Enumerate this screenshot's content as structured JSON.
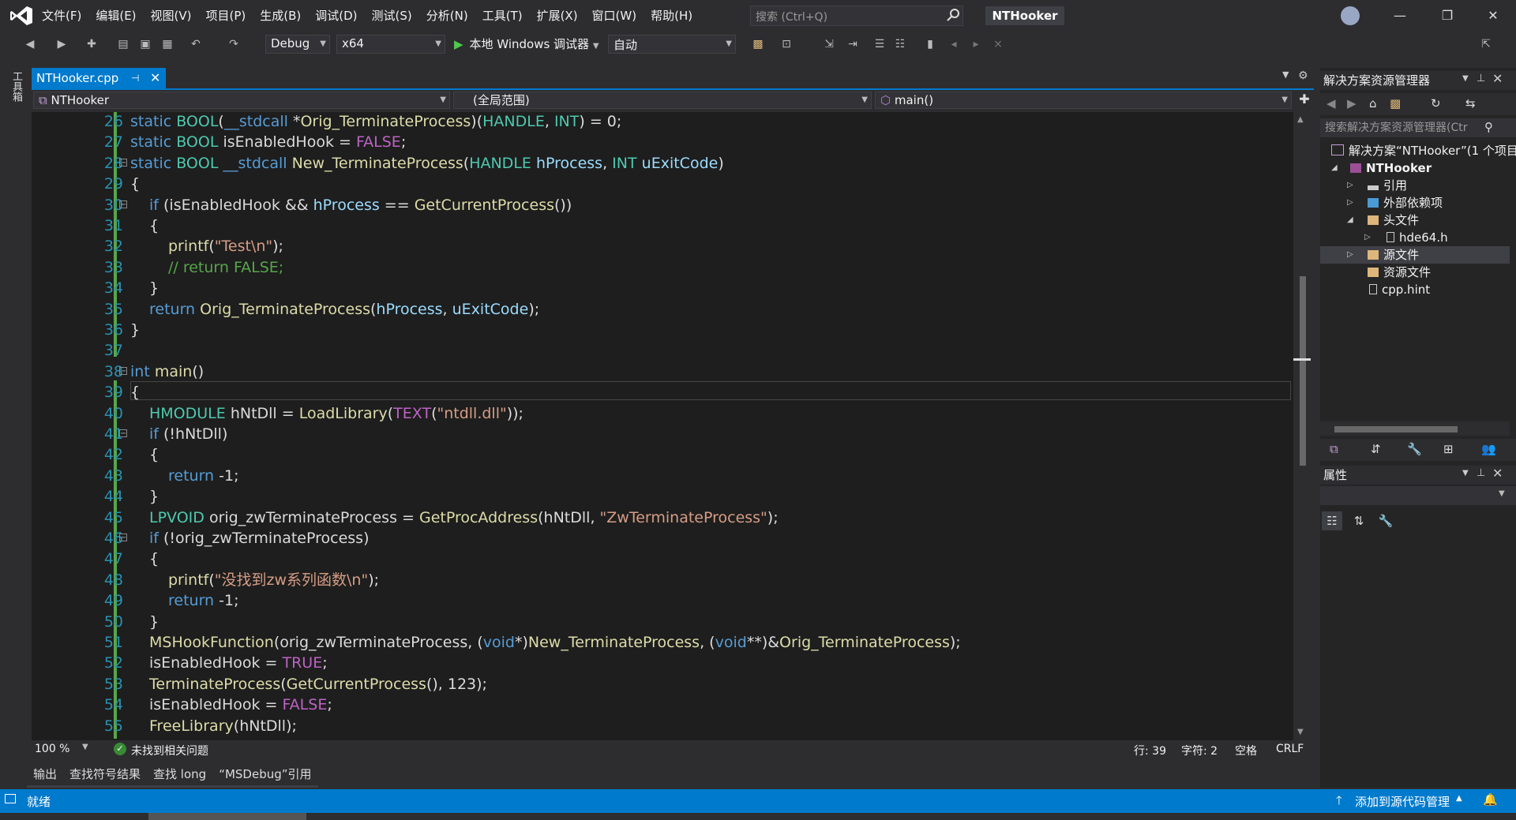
{
  "titlebar": {
    "menu": [
      "文件(F)",
      "编辑(E)",
      "视图(V)",
      "项目(P)",
      "生成(B)",
      "调试(D)",
      "测试(S)",
      "分析(N)",
      "工具(T)",
      "扩展(X)",
      "窗口(W)",
      "帮助(H)"
    ],
    "search_placeholder": "搜索 (Ctrl+Q)",
    "app_title": "NTHooker",
    "minimize": "—",
    "restore": "❐",
    "close": "✕"
  },
  "toolbar": {
    "config": "Debug",
    "platform": "x64",
    "run_label": "本地 Windows 调试器",
    "run_mode": "自动"
  },
  "toolbox_label": "工具箱",
  "editor_tab": {
    "label": "NTHooker.cpp",
    "pin": "⊣",
    "close": "✕"
  },
  "navbar": {
    "project": "NTHooker",
    "scope": "(全局范围)",
    "member": "main()"
  },
  "code_lines": [
    {
      "n": "26",
      "t": "static BOOL(__stdcall *Orig_TerminateProcess)(HANDLE, INT) = 0;"
    },
    {
      "n": "27",
      "t": "static BOOL isEnabledHook = FALSE;"
    },
    {
      "n": "28",
      "t": "static BOOL __stdcall New_TerminateProcess(HANDLE hProcess, INT uExitCode)"
    },
    {
      "n": "29",
      "t": "{"
    },
    {
      "n": "30",
      "t": "if (isEnabledHook && hProcess == GetCurrentProcess())"
    },
    {
      "n": "31",
      "t": "{"
    },
    {
      "n": "32",
      "t": "printf(\"Test\\n\");"
    },
    {
      "n": "33",
      "t": "// return FALSE;"
    },
    {
      "n": "34",
      "t": "}"
    },
    {
      "n": "35",
      "t": "return Orig_TerminateProcess(hProcess, uExitCode);"
    },
    {
      "n": "36",
      "t": "}"
    },
    {
      "n": "37",
      "t": ""
    },
    {
      "n": "38",
      "t": "int main()"
    },
    {
      "n": "39",
      "t": "{"
    },
    {
      "n": "40",
      "t": "HMODULE hNtDll = LoadLibrary(TEXT(\"ntdll.dll\"));"
    },
    {
      "n": "41",
      "t": "if (!hNtDll)"
    },
    {
      "n": "42",
      "t": "{"
    },
    {
      "n": "43",
      "t": "return -1;"
    },
    {
      "n": "44",
      "t": "}"
    },
    {
      "n": "45",
      "t": "LPVOID orig_zwTerminateProcess = GetProcAddress(hNtDll, \"ZwTerminateProcess\");"
    },
    {
      "n": "46",
      "t": "if (!orig_zwTerminateProcess)"
    },
    {
      "n": "47",
      "t": "{"
    },
    {
      "n": "48",
      "t": "printf(\"没找到zw系列函数\\n\");"
    },
    {
      "n": "49",
      "t": "return -1;"
    },
    {
      "n": "50",
      "t": "}"
    },
    {
      "n": "51",
      "t": "MSHookFunction(orig_zwTerminateProcess, (void*)New_TerminateProcess, (void**)&Orig_TerminateProcess);"
    },
    {
      "n": "52",
      "t": "isEnabledHook = TRUE;"
    },
    {
      "n": "53",
      "t": "TerminateProcess(GetCurrentProcess(), 123);"
    },
    {
      "n": "54",
      "t": "isEnabledHook = FALSE;"
    },
    {
      "n": "55",
      "t": "FreeLibrary(hNtDll);"
    }
  ],
  "editor_status": {
    "zoom": "100 %",
    "issues": "未找到相关问题",
    "line": "行: 39",
    "char": "字符: 2",
    "spaces": "空格",
    "eol": "CRLF"
  },
  "bottom_tabs": [
    "输出",
    "查找符号结果",
    "查找 long",
    "“MSDebug”引用"
  ],
  "statusbar": {
    "ready": "就绪",
    "source_control": "添加到源代码管理"
  },
  "solution_explorer": {
    "title": "解决方案资源管理器",
    "search_placeholder": "搜索解决方案资源管理器(Ctr",
    "items": [
      {
        "label": "解决方案“NTHooker”(1 个项目"
      },
      {
        "label": "NTHooker"
      },
      {
        "label": "引用"
      },
      {
        "label": "外部依赖项"
      },
      {
        "label": "头文件"
      },
      {
        "label": "hde64.h"
      },
      {
        "label": "源文件"
      },
      {
        "label": "资源文件"
      },
      {
        "label": "cpp.hint"
      }
    ]
  },
  "properties": {
    "title": "属性"
  },
  "colors": {
    "accent": "#007acc",
    "editor_bg": "#1e1e1e",
    "line_number": "#2b91af",
    "keyword": "#569cd6",
    "type": "#4ec9b0",
    "function": "#dcdcaa",
    "string": "#d69d85",
    "comment": "#57a64a"
  }
}
